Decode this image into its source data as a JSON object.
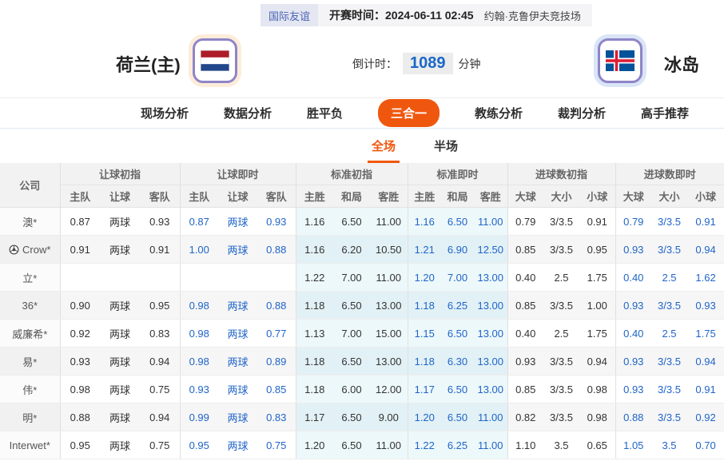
{
  "header": {
    "league_badge": "国际友谊",
    "kickoff": "开赛时间：2024-06-11 02:45",
    "venue": "约翰·克鲁伊夫竞技场"
  },
  "match": {
    "home_team": "荷兰(主)",
    "away_team": "冰岛",
    "countdown_label": "倒计时：",
    "countdown_value": "1089",
    "countdown_unit": "分钟"
  },
  "nav": {
    "tabs": [
      {
        "label": "现场分析",
        "active": false
      },
      {
        "label": "数据分析",
        "active": false
      },
      {
        "label": "胜平负",
        "active": false
      },
      {
        "label": "三合一",
        "active": true
      },
      {
        "label": "教练分析",
        "active": false
      },
      {
        "label": "裁判分析",
        "active": false
      },
      {
        "label": "高手推荐",
        "active": false
      }
    ]
  },
  "subtabs": [
    {
      "label": "全场",
      "active": true
    },
    {
      "label": "半场",
      "active": false
    }
  ],
  "table": {
    "company_header": "公司",
    "groups": [
      {
        "label": "让球初指",
        "cols": [
          "主队",
          "让球",
          "客队"
        ]
      },
      {
        "label": "让球即时",
        "cols": [
          "主队",
          "让球",
          "客队"
        ]
      },
      {
        "label": "标准初指",
        "cols": [
          "主胜",
          "和局",
          "客胜"
        ]
      },
      {
        "label": "标准即时",
        "cols": [
          "主胜",
          "和局",
          "客胜"
        ]
      },
      {
        "label": "进球数初指",
        "cols": [
          "大球",
          "大小",
          "小球"
        ]
      },
      {
        "label": "进球数即时",
        "cols": [
          "大球",
          "大小",
          "小球"
        ]
      }
    ],
    "rows": [
      {
        "company": "澳*",
        "icon": null,
        "handicap_initial": [
          "0.87",
          "两球",
          "0.93"
        ],
        "handicap_live": [
          "0.87",
          "两球",
          "0.93"
        ],
        "std_initial": [
          "1.16",
          "6.50",
          "11.00"
        ],
        "std_live": [
          "1.16",
          "6.50",
          "11.00"
        ],
        "goals_initial": [
          "0.79",
          "3/3.5",
          "0.91"
        ],
        "goals_live": [
          "0.79",
          "3/3.5",
          "0.91"
        ]
      },
      {
        "company": "Crow*",
        "icon": "soccer-ball-icon",
        "handicap_initial": [
          "0.91",
          "两球",
          "0.91"
        ],
        "handicap_live": [
          "1.00",
          "两球",
          "0.88"
        ],
        "std_initial": [
          "1.16",
          "6.20",
          "10.50"
        ],
        "std_live": [
          "1.21",
          "6.90",
          "12.50"
        ],
        "goals_initial": [
          "0.85",
          "3/3.5",
          "0.95"
        ],
        "goals_live": [
          "0.93",
          "3/3.5",
          "0.94"
        ]
      },
      {
        "company": "立*",
        "icon": null,
        "handicap_initial": [
          "",
          "",
          ""
        ],
        "handicap_live": [
          "",
          "",
          ""
        ],
        "std_initial": [
          "1.22",
          "7.00",
          "11.00"
        ],
        "std_live": [
          "1.20",
          "7.00",
          "13.00"
        ],
        "goals_initial": [
          "0.40",
          "2.5",
          "1.75"
        ],
        "goals_live": [
          "0.40",
          "2.5",
          "1.62"
        ]
      },
      {
        "company": "36*",
        "icon": null,
        "handicap_initial": [
          "0.90",
          "两球",
          "0.95"
        ],
        "handicap_live": [
          "0.98",
          "两球",
          "0.88"
        ],
        "std_initial": [
          "1.18",
          "6.50",
          "13.00"
        ],
        "std_live": [
          "1.18",
          "6.25",
          "13.00"
        ],
        "goals_initial": [
          "0.85",
          "3/3.5",
          "1.00"
        ],
        "goals_live": [
          "0.93",
          "3/3.5",
          "0.93"
        ]
      },
      {
        "company": "威廉希*",
        "icon": null,
        "handicap_initial": [
          "0.92",
          "两球",
          "0.83"
        ],
        "handicap_live": [
          "0.98",
          "两球",
          "0.77"
        ],
        "std_initial": [
          "1.13",
          "7.00",
          "15.00"
        ],
        "std_live": [
          "1.15",
          "6.50",
          "13.00"
        ],
        "goals_initial": [
          "0.40",
          "2.5",
          "1.75"
        ],
        "goals_live": [
          "0.40",
          "2.5",
          "1.75"
        ]
      },
      {
        "company": "易*",
        "icon": null,
        "handicap_initial": [
          "0.93",
          "两球",
          "0.94"
        ],
        "handicap_live": [
          "0.98",
          "两球",
          "0.89"
        ],
        "std_initial": [
          "1.18",
          "6.50",
          "13.00"
        ],
        "std_live": [
          "1.18",
          "6.30",
          "13.00"
        ],
        "goals_initial": [
          "0.93",
          "3/3.5",
          "0.94"
        ],
        "goals_live": [
          "0.93",
          "3/3.5",
          "0.94"
        ]
      },
      {
        "company": "伟*",
        "icon": null,
        "handicap_initial": [
          "0.98",
          "两球",
          "0.75"
        ],
        "handicap_live": [
          "0.93",
          "两球",
          "0.85"
        ],
        "std_initial": [
          "1.18",
          "6.00",
          "12.00"
        ],
        "std_live": [
          "1.17",
          "6.50",
          "13.00"
        ],
        "goals_initial": [
          "0.85",
          "3/3.5",
          "0.98"
        ],
        "goals_live": [
          "0.93",
          "3/3.5",
          "0.91"
        ]
      },
      {
        "company": "明*",
        "icon": null,
        "handicap_initial": [
          "0.88",
          "两球",
          "0.94"
        ],
        "handicap_live": [
          "0.99",
          "两球",
          "0.83"
        ],
        "std_initial": [
          "1.17",
          "6.50",
          "9.00"
        ],
        "std_live": [
          "1.20",
          "6.50",
          "11.00"
        ],
        "goals_initial": [
          "0.82",
          "3/3.5",
          "0.98"
        ],
        "goals_live": [
          "0.88",
          "3/3.5",
          "0.92"
        ]
      },
      {
        "company": "Interwet*",
        "icon": null,
        "handicap_initial": [
          "0.95",
          "两球",
          "0.75"
        ],
        "handicap_live": [
          "0.95",
          "两球",
          "0.75"
        ],
        "std_initial": [
          "1.20",
          "6.50",
          "11.00"
        ],
        "std_live": [
          "1.22",
          "6.25",
          "11.00"
        ],
        "goals_initial": [
          "1.10",
          "3.5",
          "0.65"
        ],
        "goals_live": [
          "1.05",
          "3.5",
          "0.70"
        ]
      }
    ]
  },
  "colors": {
    "accent_orange": "#f0570e",
    "live_blue": "#2065c9",
    "countdown_blue": "#1a67c8",
    "std_column_cyan": "#edf8fa",
    "header_gray": "#f2f2f2",
    "badge_bg": "#e4e6f2",
    "badge_text": "#4a64b2"
  }
}
